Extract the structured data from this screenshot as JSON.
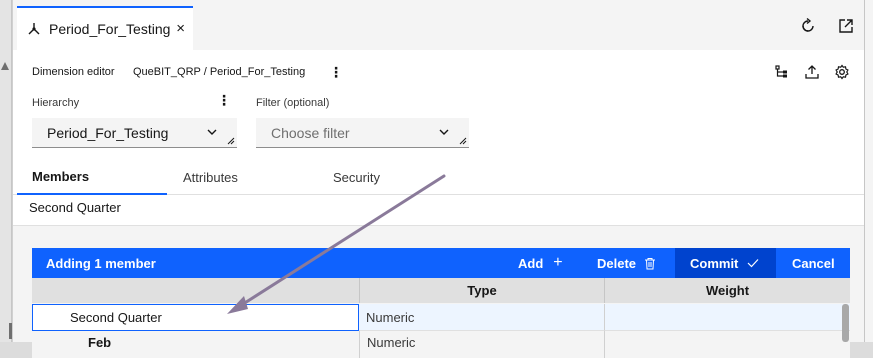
{
  "tab": {
    "title": "Period_For_Testing",
    "close": "×",
    "icon": "hierarchy-icon"
  },
  "toolbar": {
    "label": "Dimension editor",
    "path": "QueBIT_QRP / Period_For_Testing",
    "more": "⋮",
    "icons": [
      "refresh-icon",
      "launch-icon",
      "tree-view-icon",
      "upload-icon",
      "settings-icon"
    ]
  },
  "hierarchy": {
    "label": "Hierarchy",
    "more": "⋮",
    "value": "Period_For_Testing"
  },
  "filter": {
    "label": "Filter (optional)",
    "placeholder": "Choose filter"
  },
  "subtabs": [
    "Members",
    "Attributes",
    "Security"
  ],
  "selected_member": "Second Quarter",
  "action_bar": {
    "title": "Adding 1 member",
    "add": "Add",
    "add_icon": "+",
    "delete": "Delete",
    "commit": "Commit",
    "cancel": "Cancel"
  },
  "grid": {
    "columns": [
      "",
      "Type",
      "Weight"
    ],
    "rows": [
      {
        "name": "Second Quarter",
        "type": "Numeric",
        "weight": ""
      },
      {
        "name": "Feb",
        "type": "Numeric",
        "weight": ""
      }
    ]
  },
  "colors": {
    "accent": "#0f62fe",
    "commit_bg": "#0043ce",
    "annotation_arrow": "#8a7a9a"
  }
}
